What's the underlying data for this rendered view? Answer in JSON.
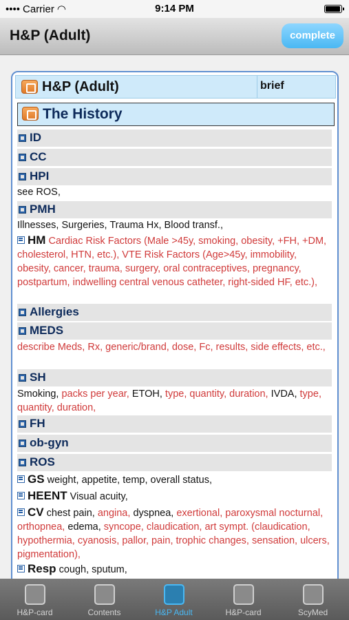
{
  "status": {
    "carrier": "Carrier",
    "time": "9:14 PM",
    "battery_level": 0.95
  },
  "nav": {
    "title": "H&P (Adult)",
    "complete_label": "complete"
  },
  "card": {
    "title": "H&P (Adult)",
    "mode": "brief",
    "history_title": "The History"
  },
  "sections": {
    "id": "ID",
    "cc": "CC",
    "hpi": "HPI",
    "pmh": "PMH",
    "allergies": "Allergies",
    "meds": "MEDS",
    "sh": "SH",
    "fh": "FH",
    "obgyn": "ob-gyn",
    "ros": "ROS"
  },
  "text": {
    "hpi_note": "see ROS,",
    "pmh_note": "Illnesses, Surgeries, Trauma Hx, Blood transf.,",
    "hm_label": "HM",
    "hm_detail": "Cardiac Risk Factors (Male >45y, smoking, obesity, +FH, +DM, cholesterol, HTN, etc.), VTE Risk Factors (Age>45y, immobility, obesity, cancer, trauma, surgery, oral contraceptives, pregnancy, postpartum, indwelling central venous catheter, right-sided HF, etc.),",
    "meds_note": "describe Meds, Rx, generic/brand, dose, Fc, results, side effects, etc.,",
    "sh_smoking": "Smoking,",
    "sh_packs": "packs per year,",
    "sh_etoh": "ETOH,",
    "sh_etoh_detail": "type, quantity, duration,",
    "sh_ivda": "IVDA,",
    "sh_ivda_detail": "type, quantity, duration,",
    "gs_label": "GS",
    "gs_detail": "weight, appetite, temp, overall status,",
    "heent_label": "HEENT",
    "heent_detail": "Visual acuity,",
    "cv_label": "CV",
    "cv_chest": "chest pain,",
    "cv_angina": "angina,",
    "cv_dyspnea": "dyspnea,",
    "cv_exertional": "exertional, paroxysmal nocturnal, orthopnea,",
    "cv_edema": "edema,",
    "cv_rest": "syncope, claudication, art sympt. (claudication, hypothermia, cyanosis, pallor, pain, trophic changes, sensation, ulcers, pigmentation),",
    "resp_label": "Resp",
    "resp_detail": "cough, sputum,"
  },
  "tabs": [
    {
      "label": "H&P-card",
      "icon": "card-icon"
    },
    {
      "label": "Contents",
      "icon": "contents-icon"
    },
    {
      "label": "H&P Adult",
      "icon": "hp-adult-icon"
    },
    {
      "label": "H&P-card",
      "icon": "card-edit-icon"
    },
    {
      "label": "ScyMed",
      "icon": "scymed-icon"
    }
  ],
  "active_tab": 2
}
